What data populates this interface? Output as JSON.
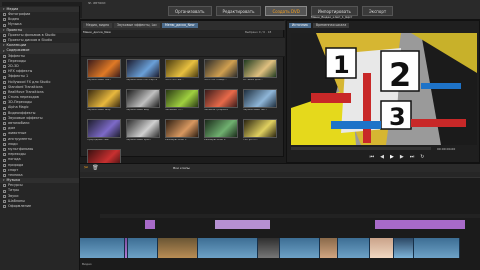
{
  "app": {
    "window_title": "Ф. автоки",
    "main_tabs": [
      {
        "label": "Организовать",
        "active": false
      },
      {
        "label": "Редактировать",
        "active": false
      },
      {
        "label": "Создать DVD",
        "active": true
      },
      {
        "label": "Импортировать",
        "active": false
      },
      {
        "label": "Экспорт",
        "active": false
      }
    ]
  },
  "left_panel": {
    "items": [
      {
        "label": "Медиа",
        "type": "header"
      },
      {
        "label": "Фотографии",
        "type": "item"
      },
      {
        "label": "Видео",
        "type": "item"
      },
      {
        "label": "Музыка",
        "type": "item"
      },
      {
        "label": "Проекты",
        "type": "header"
      },
      {
        "label": "Проекты фильмов в Studio",
        "type": "item"
      },
      {
        "label": "Проекты дисков в Studio",
        "type": "item"
      },
      {
        "label": "Коллекции",
        "type": "header"
      },
      {
        "label": "Содержимое",
        "type": "header"
      },
      {
        "label": "Эффекты",
        "type": "item"
      },
      {
        "label": "Переходы",
        "type": "item"
      },
      {
        "label": "2D-3D",
        "type": "item"
      },
      {
        "label": "HFX эффекты",
        "type": "item"
      },
      {
        "label": "Эффекты 1",
        "type": "item"
      },
      {
        "label": "Hollywood FX для Studio",
        "type": "item"
      },
      {
        "label": "Standard Transitions",
        "type": "item"
      },
      {
        "label": "RealMove Transitions",
        "type": "item"
      },
      {
        "label": "Стиль переходов",
        "type": "item"
      },
      {
        "label": "3D-Переходы",
        "type": "item"
      },
      {
        "label": "Alpha Magic",
        "type": "item"
      },
      {
        "label": "Видеоэффекты",
        "type": "item"
      },
      {
        "label": "Звуковые эффекты",
        "type": "item"
      },
      {
        "label": "автомобили",
        "type": "item"
      },
      {
        "label": "дом",
        "type": "item"
      },
      {
        "label": "животные",
        "type": "item"
      },
      {
        "label": "инструменты",
        "type": "item"
      },
      {
        "label": "люди",
        "type": "item"
      },
      {
        "label": "мультфильмы",
        "type": "item"
      },
      {
        "label": "переходы",
        "type": "item"
      },
      {
        "label": "погода",
        "type": "item"
      },
      {
        "label": "природа",
        "type": "item"
      },
      {
        "label": "спорт",
        "type": "item"
      },
      {
        "label": "техника",
        "type": "item"
      },
      {
        "label": "Музыка",
        "type": "header"
      },
      {
        "label": "Ресурсы",
        "type": "item"
      },
      {
        "label": "Титры",
        "type": "item"
      },
      {
        "label": "Звуки",
        "type": "item"
      },
      {
        "label": "Шаблоны",
        "type": "item"
      },
      {
        "label": "Оформление",
        "type": "item"
      }
    ]
  },
  "library": {
    "tabs": [
      {
        "label": "Медиа, видео",
        "active": false
      },
      {
        "label": "Звуковые эффекты, Loc",
        "active": false
      },
      {
        "label": "Меню_диска_New",
        "active": true
      }
    ],
    "status": "Выбрано 0 / 6 · 18",
    "breadcrumb": "Меню_диска_New",
    "thumbs": [
      {
        "caption": "Зарамочный свет"
      },
      {
        "caption": "Зарамочная поп-карта"
      },
      {
        "caption": "Золотистые..."
      },
      {
        "caption": "Золотой плеер..."
      },
      {
        "caption": "Вставка фон..."
      },
      {
        "caption": "Зарамочный шар"
      },
      {
        "caption": "Зарамочный вид"
      },
      {
        "caption": "Зеленый HF..."
      },
      {
        "caption": "Зеленая графика"
      },
      {
        "caption": "Зарамочный лист"
      },
      {
        "caption": "Природный свет"
      },
      {
        "caption": "Зарамочный крест"
      },
      {
        "caption": "Размеры кино 1"
      },
      {
        "caption": "Размеры кино 2"
      },
      {
        "caption": "Тип фото..."
      },
      {
        "caption": "Цветной пейзаж"
      }
    ]
  },
  "preview": {
    "title": "Меню_Видео_клип_1_Щит",
    "tabs": [
      {
        "label": "Источник",
        "active": true
      },
      {
        "label": "Временная шкала",
        "active": false
      }
    ],
    "numbers": [
      "1",
      "2",
      "3"
    ],
    "timecode": "00:00:00.00"
  },
  "timeline": {
    "toolbar_label": "Мои клипы",
    "track_name": "Видео"
  },
  "colors": {
    "accent": "#f4a020",
    "selected": "#4b6b8c"
  }
}
